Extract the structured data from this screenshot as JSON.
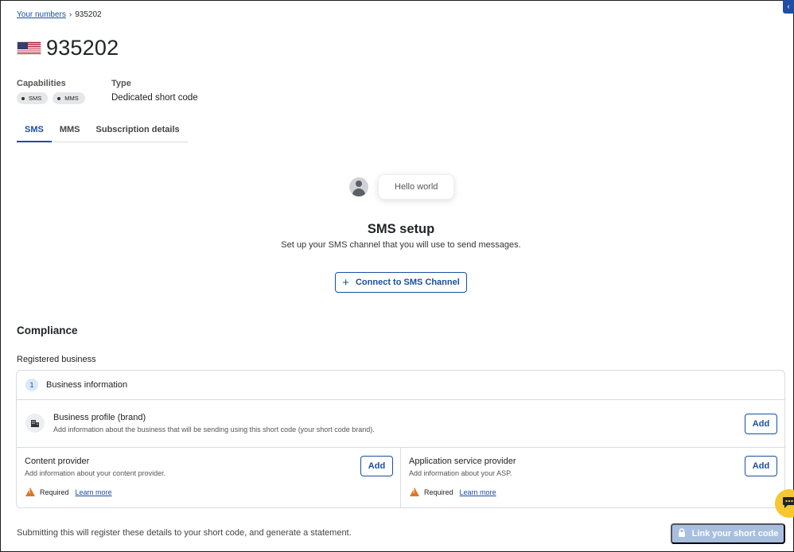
{
  "breadcrumb": {
    "parent_link": "Your numbers",
    "separator_icon": "chevron-right-icon",
    "current": "935202"
  },
  "header": {
    "flag_icon": "us-flag-icon",
    "title": "935202"
  },
  "capabilities": {
    "label": "Capabilities",
    "chips": [
      "SMS",
      "MMS"
    ]
  },
  "type": {
    "label": "Type",
    "value": "Dedicated short code"
  },
  "tabs": [
    {
      "label": "SMS",
      "active": true
    },
    {
      "label": "MMS",
      "active": false
    },
    {
      "label": "Subscription details",
      "active": false
    }
  ],
  "sms_setup": {
    "bubble_text": "Hello world",
    "title": "SMS setup",
    "description": "Set up your SMS channel that you will use to send messages.",
    "connect_button": "Connect to SMS Channel"
  },
  "compliance": {
    "title": "Compliance",
    "registered_label": "Registered business",
    "step_number": "1",
    "section_title": "Business information",
    "brand": {
      "title": "Business profile (brand)",
      "description": "Add information about the business that will be sending using this short code (your short code brand).",
      "add_label": "Add"
    },
    "content_provider": {
      "title": "Content provider",
      "description": "Add information about your content provider.",
      "add_label": "Add",
      "required_label": "Required",
      "learn_more": "Learn more"
    },
    "asp": {
      "title": "Application service provider",
      "description": "Add information about your ASP.",
      "add_label": "Add",
      "required_label": "Required",
      "learn_more": "Learn more"
    }
  },
  "footer": {
    "text": "Submitting this will register these details to your short code, and generate a statement.",
    "link_button": "Link your short code"
  },
  "colors": {
    "accent": "#1a4fa0",
    "disabled_button": "#a9bfdf",
    "warning": "#d9772b",
    "chat_fab": "#f7c630"
  }
}
